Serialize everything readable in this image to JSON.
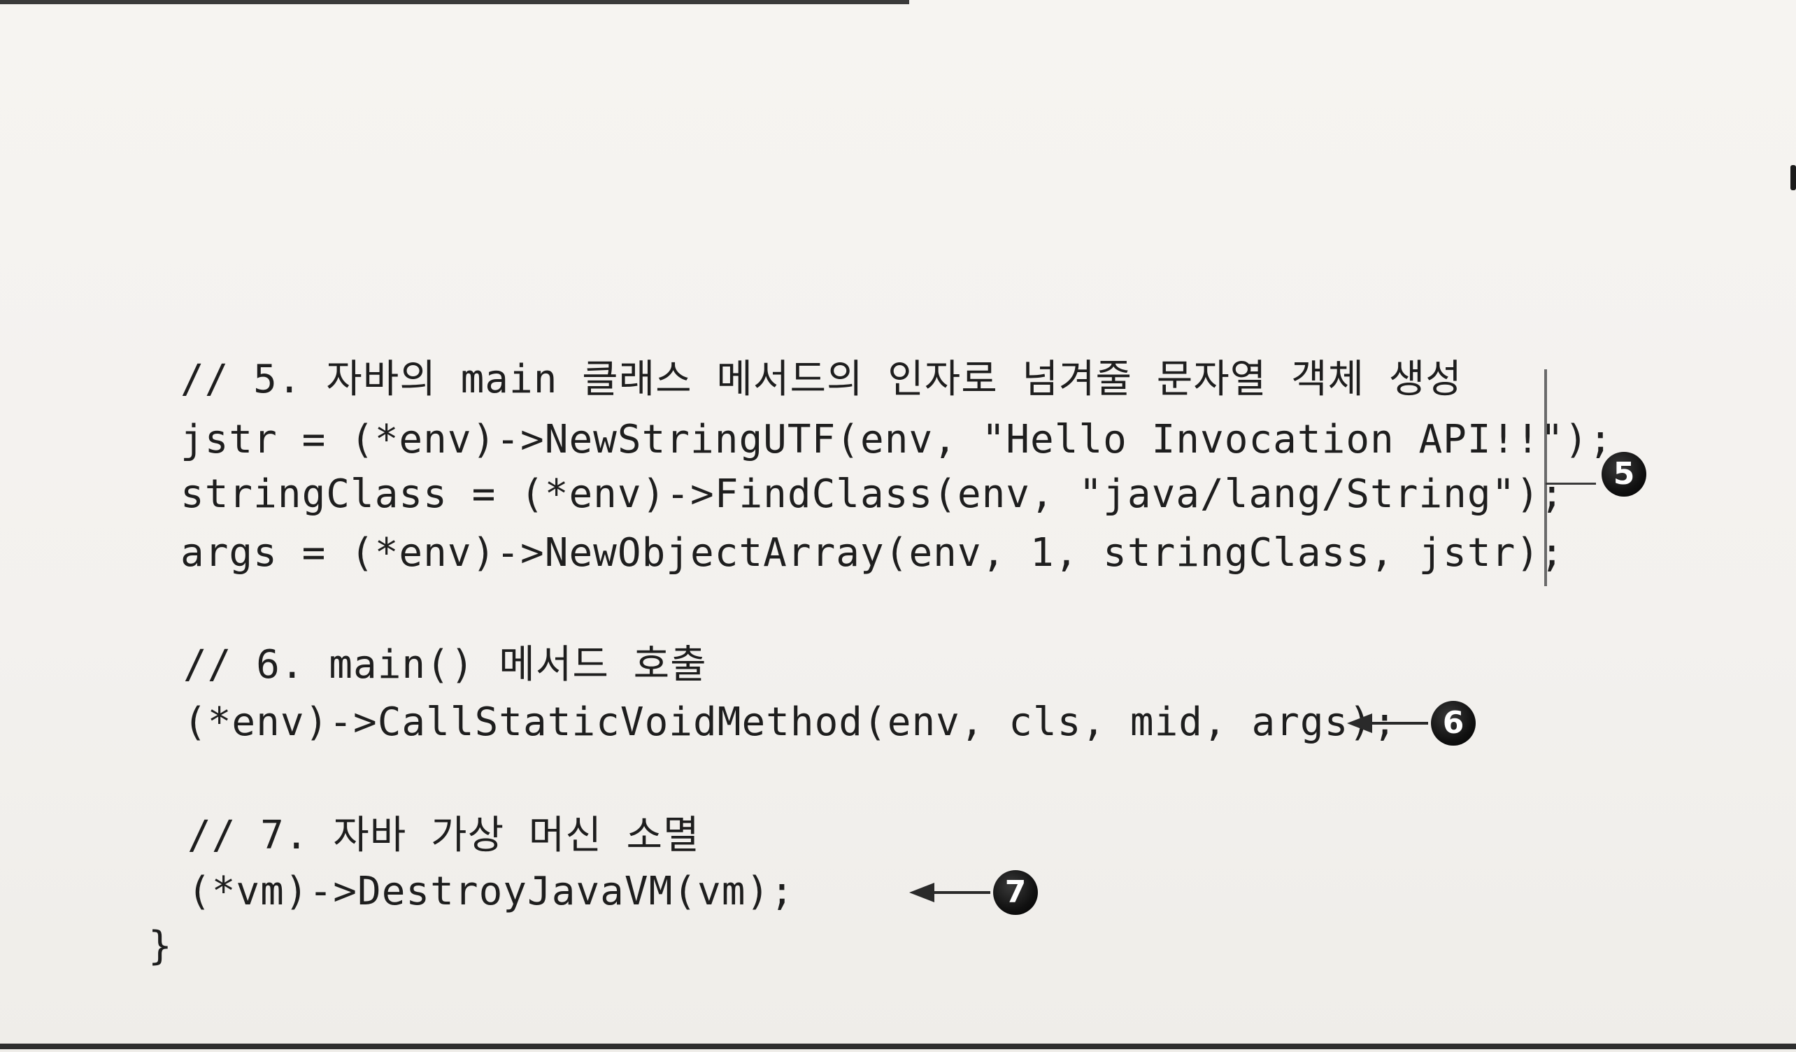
{
  "code": {
    "lines": [
      "// 5. 자바의 main 클래스 메서드의 인자로 넘겨줄 문자열 객체 생성",
      "jstr = (*env)->NewStringUTF(env, \"Hello Invocation API!!\");",
      "stringClass = (*env)->FindClass(env, \"java/lang/String\");",
      "args = (*env)->NewObjectArray(env, 1, stringClass, jstr);",
      "// 6. main() 메서드 호출",
      "(*env)->CallStaticVoidMethod(env, cls, mid, args);",
      "// 7. 자바 가상 머신 소멸",
      "(*vm)->DestroyJavaVM(vm);",
      "}"
    ]
  },
  "markers": {
    "m5": "5",
    "m6": "6",
    "m7": "7"
  },
  "colors": {
    "text": "#1e1e1e",
    "marker_fill": "#111111",
    "marker_text": "#ffffff",
    "paper": "#f3f1ee"
  }
}
